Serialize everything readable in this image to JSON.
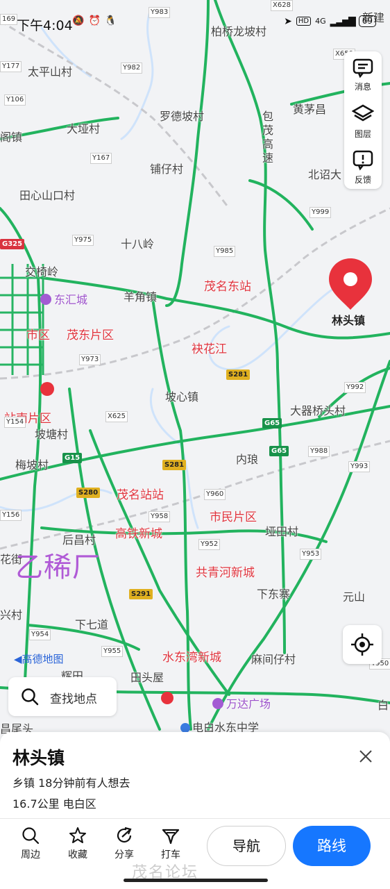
{
  "status_bar": {
    "time": "下午4:04",
    "network": "4G",
    "battery": "69"
  },
  "map": {
    "labels": {
      "xinjian": "新建",
      "baiqiao": "柏桥龙坡村",
      "taipingshan": "太平山村",
      "luodepo": "罗德坡村",
      "huangmao": "黄茅昌",
      "ge": "阁镇",
      "daya": "大垭村",
      "baomao": "包茂高速",
      "puzai": "铺仔村",
      "beizhao": "北诏大",
      "tianxinshankou": "田心山口村",
      "shibaling": "十八岭",
      "jiaoyiling": "交椅岭",
      "donghui": "东汇城",
      "yangjiao": "羊角镇",
      "maomingdong": "茂名东站",
      "linzhen_pin": "林头镇",
      "shiqu": "市区",
      "maodong": "茂东片区",
      "qihuajiang": "袂花江",
      "poxin": "坡心镇",
      "dajiqiao": "大器桥头村",
      "zhannan": "站南片区",
      "potang": "坡塘村",
      "neilang": "内琅",
      "meipo": "梅坡村",
      "maomingzhan": "茂名站站",
      "shimin": "市民片区",
      "houchang": "后昌村",
      "gaotie": "高铁新城",
      "yatian": "垭田村",
      "huajie": "花街",
      "gongqinghe": "共青河新城",
      "xiadongzhai": "下东寨",
      "yuanshan": "元山",
      "xing": "兴村",
      "xiaqidao": "下七道",
      "shuidongwan": "水东湾新城",
      "majianzai": "麻间仔村",
      "hui": "辉田",
      "tiantouwu": "田头屋",
      "wanda": "万达广场",
      "bai": "白",
      "changwei": "昌尾头",
      "dianbai": "电白水东中学"
    },
    "road_codes": {
      "y983": "Y983",
      "x628": "X628",
      "x650": "X650",
      "y177": "Y177",
      "y982": "Y982",
      "y106": "Y106",
      "y167": "Y167",
      "y999": "Y999",
      "g325": "G325",
      "y975": "Y975",
      "y985": "Y985",
      "y973": "Y973",
      "s281a": "S281",
      "y992": "Y992",
      "x625": "X625",
      "g65a": "G65",
      "y154": "Y154",
      "g65b": "G65",
      "y988": "Y988",
      "g15": "G15",
      "s281b": "S281",
      "y993": "Y993",
      "s280": "S280",
      "y960": "Y960",
      "y156": "Y156",
      "y958": "Y958",
      "y952": "Y952",
      "y953": "Y953",
      "s291": "S291",
      "y954": "Y954",
      "y955": "Y955",
      "y950": "Y950",
      "r169": "169"
    },
    "overlay_text": "乙稀厂",
    "amap_logo": "高德地图"
  },
  "right_panel": {
    "messages": "消息",
    "layers": "图层",
    "feedback": "反馈"
  },
  "search": {
    "label": "查找地点"
  },
  "sheet": {
    "title": "林头镇",
    "category_line": "乡镇  18分钟前有人想去",
    "distance_line": "16.7公里  电白区",
    "actions": {
      "nearby": "周边",
      "favorite": "收藏",
      "share": "分享",
      "taxi": "打车"
    },
    "navigate": "导航",
    "route": "路线"
  },
  "watermark": "茂名论坛",
  "colors": {
    "road_green": "#22b35e",
    "accent_blue": "#1677ff",
    "pin_red": "#e8323c"
  }
}
